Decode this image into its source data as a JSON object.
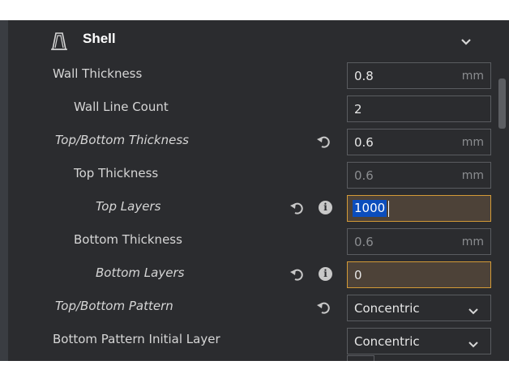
{
  "section": {
    "title": "Shell",
    "icon": "shell-icon",
    "collapse_icon": "chevron-down-icon"
  },
  "settings": [
    {
      "label": "Wall Thickness",
      "value": "0.8",
      "unit": "mm"
    },
    {
      "label": "Wall Line Count",
      "value": "2"
    },
    {
      "label": "Top/Bottom Thickness",
      "value": "0.6",
      "unit": "mm",
      "modified": true
    },
    {
      "label": "Top Thickness",
      "value": "0.6",
      "unit": "mm",
      "disabled": true
    },
    {
      "label": "Top Layers",
      "value": "1000",
      "modified": true,
      "info": true,
      "highlighted": true,
      "text_selected": true
    },
    {
      "label": "Bottom Thickness",
      "value": "0.6",
      "unit": "mm",
      "disabled": true
    },
    {
      "label": "Bottom Layers",
      "value": "0",
      "modified": true,
      "info": true,
      "highlighted": true
    },
    {
      "label": "Top/Bottom Pattern",
      "value": "Concentric",
      "modified": true,
      "type": "dropdown"
    },
    {
      "label": "Bottom Pattern Initial Layer",
      "value": "Concentric",
      "type": "dropdown"
    }
  ],
  "colors": {
    "panel_bg": "#2b2c2f",
    "field_border": "#5a5c60",
    "highlight_border": "#d39a37",
    "highlight_bg": "#4d4238",
    "selection": "#0b4dbd"
  }
}
